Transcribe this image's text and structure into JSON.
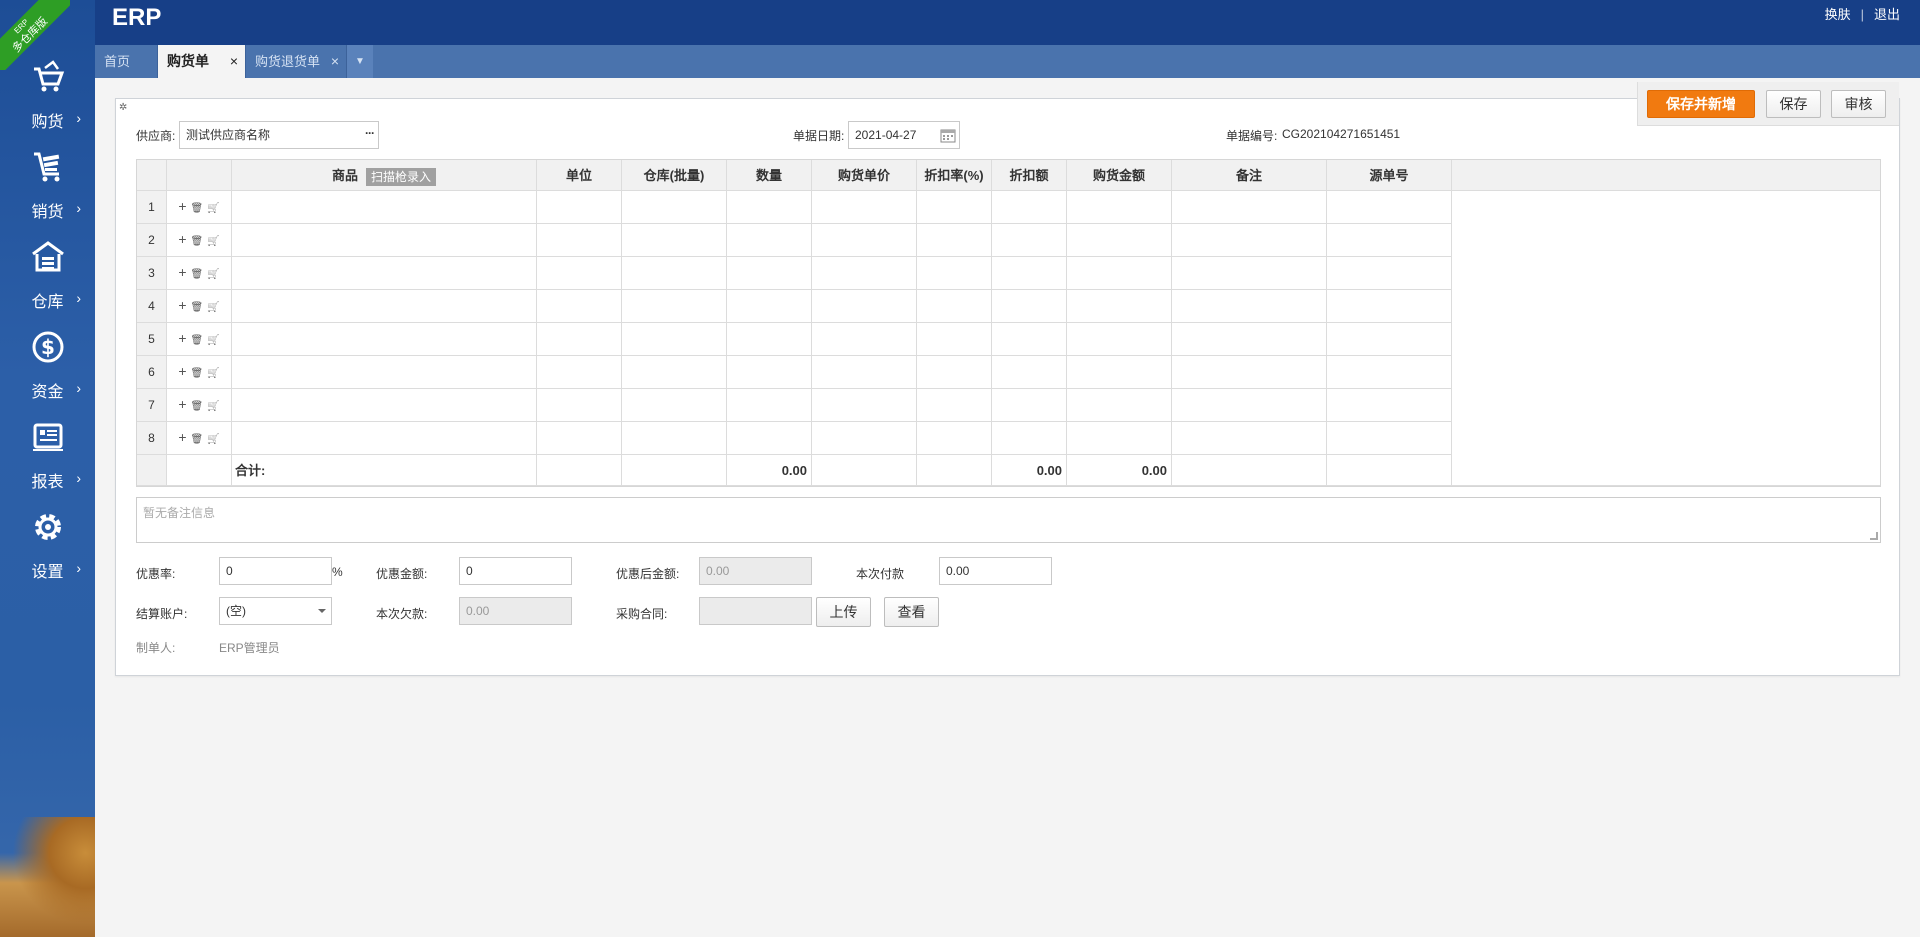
{
  "app": {
    "brand": "ERP",
    "ribbon_small": "ERP",
    "ribbon_text": "多仓库版"
  },
  "top_links": {
    "skin": "换肤",
    "sep": "|",
    "logout": "退出"
  },
  "sidebar": {
    "items": [
      {
        "label": "购货",
        "icon": "cart-icon"
      },
      {
        "label": "销货",
        "icon": "cart-list-icon"
      },
      {
        "label": "仓库",
        "icon": "warehouse-icon"
      },
      {
        "label": "资金",
        "icon": "dollar-icon"
      },
      {
        "label": "报表",
        "icon": "report-icon"
      },
      {
        "label": "设置",
        "icon": "gear-icon"
      }
    ],
    "arrow": "›"
  },
  "tabs": [
    {
      "label": "首页",
      "closable": false,
      "active": false
    },
    {
      "label": "购货单",
      "closable": true,
      "active": true
    },
    {
      "label": "购货退货单",
      "closable": true,
      "active": false
    }
  ],
  "tab_close": "×",
  "tab_more": "▼",
  "actions": {
    "save_new": "保存并新增",
    "save": "保存",
    "audit": "审核"
  },
  "header": {
    "supplier_label": "供应商:",
    "supplier_value": "测试供应商名称",
    "supplier_btn": "···",
    "date_label": "单据日期:",
    "date_value": "2021-04-27",
    "number_label": "单据编号:",
    "number_value": "CG202104271651451"
  },
  "grid": {
    "columns": [
      "",
      "",
      "商品",
      "单位",
      "仓库(批量)",
      "数量",
      "购货单价",
      "折扣率(%)",
      "折扣额",
      "购货金额",
      "备注",
      "源单号"
    ],
    "scan_label": "扫描枪录入",
    "rows": [
      "1",
      "2",
      "3",
      "4",
      "5",
      "6",
      "7",
      "8"
    ],
    "ops": [
      "+",
      "🗑",
      "🛒"
    ],
    "total_label": "合计:",
    "total_qty": "0.00",
    "total_discount": "0.00",
    "total_amount": "0.00"
  },
  "remark_placeholder": "暂无备注信息",
  "footer": {
    "discount_rate_label": "优惠率:",
    "discount_rate_value": "0",
    "percent": "%",
    "discount_amount_label": "优惠金额:",
    "discount_amount_value": "0",
    "after_discount_label": "优惠后金额:",
    "after_discount_value": "0.00",
    "paid_label": "本次付款",
    "paid_value": "0.00",
    "account_label": "结算账户:",
    "account_value": "(空)",
    "debt_label": "本次欠款:",
    "debt_value": "0.00",
    "contract_label": "采购合同:",
    "contract_value": "",
    "upload_btn": "上传",
    "view_btn": "查看",
    "maker_label": "制单人:",
    "maker_value": "ERP管理员"
  },
  "colors": {
    "topbar": "#173f87",
    "sidebar": "#2c5fa8",
    "tabbar": "#4a73ad",
    "accent": "#f17a10",
    "ribbon": "#2e9e25"
  }
}
